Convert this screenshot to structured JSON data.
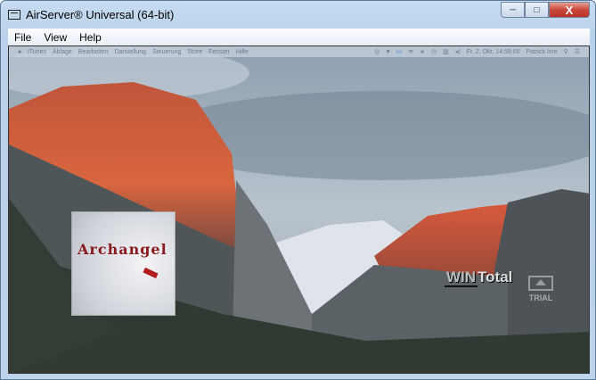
{
  "window": {
    "title": "AirServer® Universal (64-bit)",
    "minimize": "─",
    "maximize": "□",
    "close": "X"
  },
  "menu": [
    "File",
    "View",
    "Help"
  ],
  "mac_menubar": {
    "items": [
      "iTunes",
      "Ablage",
      "Bearbeiten",
      "Darstellung",
      "Steuerung",
      "Store",
      "Fenster",
      "Hilfe"
    ],
    "clock": "Fr. 2. Okt.  14:59:05",
    "user": "Patrick Ime"
  },
  "album": {
    "title": "Archangel"
  },
  "watermark": {
    "brand_a": "WIN",
    "brand_b": "Total",
    "trial": "TRIAL"
  }
}
